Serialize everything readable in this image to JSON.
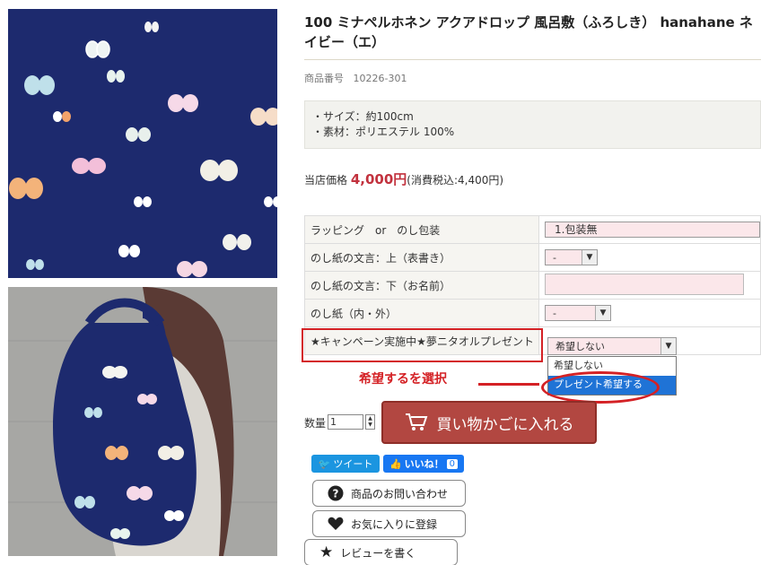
{
  "product": {
    "title": "100 ミナペルホネン アクアドロップ 風呂敷（ふろしき） hanahane ネイビー（エ）",
    "sku_label": "商品番号",
    "sku": "10226-301",
    "specs": [
      "・サイズ：約100cm",
      "・素材：ポリエステル 100%"
    ],
    "price_label": "当店価格",
    "price": "4,000円",
    "price_tax": "(消費税込:4,400円)"
  },
  "options": {
    "rows": [
      {
        "label": "ラッピング　or　のし包装",
        "value": "1.包装無"
      },
      {
        "label": "のし紙の文言：上（表書き）",
        "value": "-"
      },
      {
        "label": "のし紙の文言：下（お名前）",
        "value": ""
      },
      {
        "label": "のし紙（内・外）",
        "value": "-"
      },
      {
        "label": "★キャンペーン実施中★夢ニタオルプレゼント",
        "value": "希望しない"
      }
    ],
    "dropdown_items": [
      "希望しない",
      "プレゼント希望する"
    ],
    "dropdown_selected_index": 1
  },
  "annotation": {
    "text": "希望するを選択"
  },
  "cart": {
    "qty_label": "数量",
    "qty": "1",
    "button": "買い物かごに入れる"
  },
  "social": {
    "tweet": "ツイート",
    "like": "いいね！",
    "like_count": "0"
  },
  "actions": {
    "inquiry": "商品のお問い合わせ",
    "favorite": "お気に入りに登録",
    "review": "レビューを書く"
  }
}
